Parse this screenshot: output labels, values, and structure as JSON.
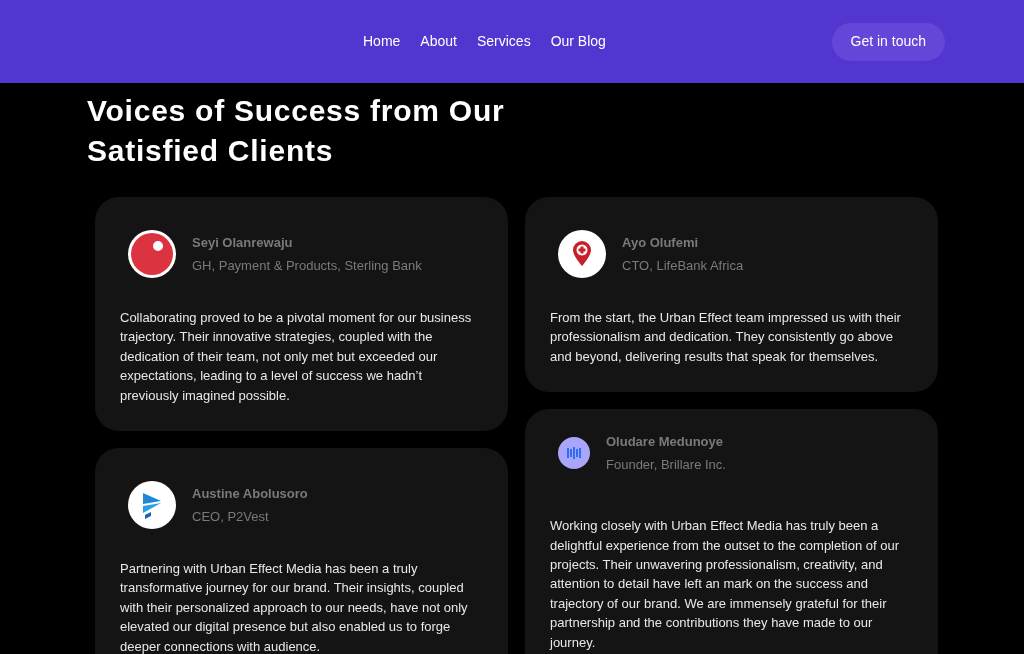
{
  "nav": {
    "links": [
      "Home",
      "About",
      "Services",
      "Our Blog"
    ],
    "cta": "Get in touch"
  },
  "heading": "Voices of Success from Our Satisfied Clients",
  "columns": [
    [
      {
        "kind": "red-dot",
        "name": "Seyi Olanrewaju",
        "role": "GH, Payment & Products, Sterling Bank",
        "quote": "Collaborating proved to be a pivotal moment for our business trajectory. Their innovative strategies, coupled with the dedication of their team, not only met but exceeded our expectations, leading to a level of success we hadn’t previously imagined possible."
      },
      {
        "kind": "blue-arrows",
        "name": "Austine Abolusoro",
        "role": "CEO, P2Vest",
        "quote": "Partnering with Urban Effect Media has been a truly transformative journey for our brand. Their insights, coupled with their personalized approach to our needs, have not only elevated our digital presence but also enabled us to forge deeper connections with audience."
      }
    ],
    [
      {
        "kind": "red-pin",
        "name": "Ayo Olufemi",
        "role": "CTO, LifeBank Africa",
        "quote": "From the start, the Urban Effect team impressed us with their professionalism and dedication. They consistently go above and beyond, delivering results that speak for themselves."
      },
      {
        "kind": "bars",
        "name": "Oludare Medunoye",
        "role": "Founder, Brillare Inc.",
        "quote": "Working closely with Urban Effect Media has truly been a delightful experience from the outset to the completion of our projects. Their unwavering professionalism, creativity, and attention to detail have left an mark on the success and trajectory of our brand. We are immensely grateful for their partnership and the contributions they have made to our journey."
      }
    ]
  ]
}
